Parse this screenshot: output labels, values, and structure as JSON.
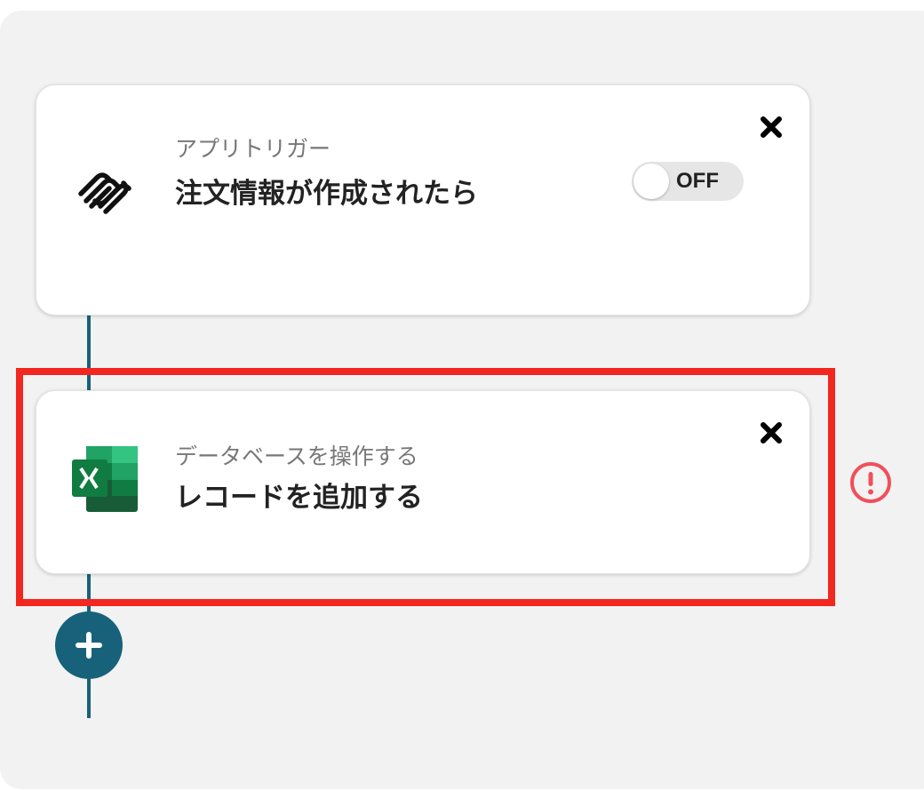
{
  "steps": [
    {
      "category": "アプリトリガー",
      "title": "注文情報が作成されたら",
      "icon": "squarespace-logo-icon",
      "toggle": {
        "state": "OFF"
      }
    },
    {
      "category": "データベースを操作する",
      "title": "レコードを追加する",
      "icon": "excel-logo-icon"
    }
  ],
  "colors": {
    "accent": "#17627a",
    "highlight": "#f2271f",
    "warning": "#f0505a",
    "panel": "#f2f2f2"
  }
}
